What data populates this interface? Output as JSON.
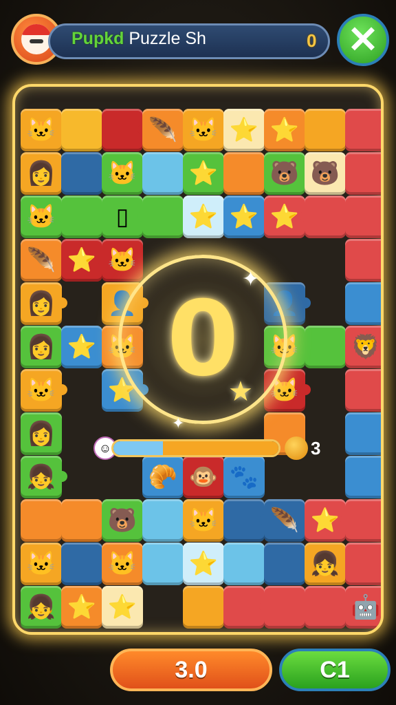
{
  "header": {
    "title_green": "Pupkd",
    "title_rest": " Puzzle Sh",
    "score": "0",
    "close_symbol": "✕",
    "avatar_icon": "mushroom-hat-avatar-icon"
  },
  "board": {
    "center_value": "0",
    "progress_fraction": 0.3,
    "coin_count": "3",
    "rows": [
      [
        {
          "c": "#f5a623",
          "i": "🐱"
        },
        {
          "c": "#f7b92c",
          "i": ""
        },
        {
          "c": "#c92a2a",
          "i": ""
        },
        {
          "c": "#f58b2a",
          "i": "🪶"
        },
        {
          "c": "#f5a623",
          "i": "🐱"
        },
        {
          "c": "#fbe8b0",
          "i": "⭐"
        },
        {
          "c": "#f58b2a",
          "i": "⭐"
        },
        {
          "c": "#f5a623",
          "i": ""
        },
        {
          "c": "#e04a4a",
          "i": ""
        }
      ],
      [
        {
          "c": "#f5a623",
          "i": "👩"
        },
        {
          "c": "#2f6aa5",
          "i": ""
        },
        {
          "c": "#55c23c",
          "i": "🐱"
        },
        {
          "c": "#6cc3e8",
          "i": ""
        },
        {
          "c": "#55c23c",
          "i": "⭐"
        },
        {
          "c": "#f58b2a",
          "i": ""
        },
        {
          "c": "#55c23c",
          "i": "🐻"
        },
        {
          "c": "#fbe8b0",
          "i": "🐻"
        },
        {
          "c": "#e04a4a",
          "i": ""
        }
      ],
      [
        {
          "c": "#55c23c",
          "i": "🐱"
        },
        {
          "c": "#55c23c",
          "i": ""
        },
        {
          "c": "#55c23c",
          "i": "▯"
        },
        {
          "c": "#55c23c",
          "i": ""
        },
        {
          "c": "#cfeefa",
          "i": "⭐"
        },
        {
          "c": "#3b8ed1",
          "i": "⭐"
        },
        {
          "c": "#e04a4a",
          "i": "⭐"
        },
        {
          "c": "#e04a4a",
          "i": ""
        },
        {
          "c": "#e04a4a",
          "i": ""
        }
      ],
      [
        {
          "c": "#f58b2a",
          "i": "🪶"
        },
        {
          "c": "#c92a2a",
          "i": "⭐"
        },
        {
          "c": "#c92a2a",
          "i": "🐱"
        },
        {
          "c": "#2a241c",
          "i": ""
        },
        {
          "c": "#2a241c",
          "i": ""
        },
        {
          "c": "#2a241c",
          "i": ""
        },
        {
          "c": "#2a241c",
          "i": ""
        },
        {
          "c": "#2a241c",
          "i": ""
        },
        {
          "c": "#e04a4a",
          "i": ""
        }
      ],
      [
        {
          "c": "#f5a623",
          "i": "👩"
        },
        {
          "c": "#2a241c",
          "i": ""
        },
        {
          "c": "#f5a623",
          "i": "👤"
        },
        {
          "c": "#2a241c",
          "i": ""
        },
        {
          "c": "#2a241c",
          "i": ""
        },
        {
          "c": "#2a241c",
          "i": ""
        },
        {
          "c": "#2f6aa5",
          "i": "👤"
        },
        {
          "c": "#2a241c",
          "i": ""
        },
        {
          "c": "#3b8ed1",
          "i": ""
        }
      ],
      [
        {
          "c": "#55c23c",
          "i": "👩"
        },
        {
          "c": "#3b8ed1",
          "i": "⭐"
        },
        {
          "c": "#f58b2a",
          "i": "🐱"
        },
        {
          "c": "#2a241c",
          "i": ""
        },
        {
          "c": "#2a241c",
          "i": ""
        },
        {
          "c": "#2a241c",
          "i": ""
        },
        {
          "c": "#55c23c",
          "i": "🐱"
        },
        {
          "c": "#55c23c",
          "i": ""
        },
        {
          "c": "#e04a4a",
          "i": "🦁"
        }
      ],
      [
        {
          "c": "#f5a623",
          "i": "🐱"
        },
        {
          "c": "#2a241c",
          "i": ""
        },
        {
          "c": "#3b8ed1",
          "i": "⭐"
        },
        {
          "c": "#2a241c",
          "i": ""
        },
        {
          "c": "#2a241c",
          "i": ""
        },
        {
          "c": "#2a241c",
          "i": ""
        },
        {
          "c": "#c92a2a",
          "i": "🐱"
        },
        {
          "c": "#2a241c",
          "i": ""
        },
        {
          "c": "#e04a4a",
          "i": ""
        }
      ],
      [
        {
          "c": "#55c23c",
          "i": "👩"
        },
        {
          "c": "#2a241c",
          "i": ""
        },
        {
          "c": "#2a241c",
          "i": ""
        },
        {
          "c": "#2a241c",
          "i": ""
        },
        {
          "c": "#2a241c",
          "i": ""
        },
        {
          "c": "#2a241c",
          "i": ""
        },
        {
          "c": "#f58b2a",
          "i": ""
        },
        {
          "c": "#2a241c",
          "i": ""
        },
        {
          "c": "#3b8ed1",
          "i": ""
        }
      ],
      [
        {
          "c": "#55c23c",
          "i": "👧"
        },
        {
          "c": "#2a241c",
          "i": ""
        },
        {
          "c": "#2a241c",
          "i": ""
        },
        {
          "c": "#3b8ed1",
          "i": "🥐"
        },
        {
          "c": "#c92a2a",
          "i": "🐵"
        },
        {
          "c": "#3b8ed1",
          "i": "🐾"
        },
        {
          "c": "#2a241c",
          "i": ""
        },
        {
          "c": "#2a241c",
          "i": ""
        },
        {
          "c": "#3b8ed1",
          "i": ""
        }
      ],
      [
        {
          "c": "#f58b2a",
          "i": ""
        },
        {
          "c": "#f58b2a",
          "i": ""
        },
        {
          "c": "#55c23c",
          "i": "🐻"
        },
        {
          "c": "#6cc3e8",
          "i": ""
        },
        {
          "c": "#f5a623",
          "i": "🐱"
        },
        {
          "c": "#2f6aa5",
          "i": ""
        },
        {
          "c": "#2f6aa5",
          "i": "🪶"
        },
        {
          "c": "#e04a4a",
          "i": "⭐"
        },
        {
          "c": "#e04a4a",
          "i": ""
        }
      ],
      [
        {
          "c": "#f5a623",
          "i": "🐱"
        },
        {
          "c": "#2f6aa5",
          "i": ""
        },
        {
          "c": "#f58b2a",
          "i": "🐱"
        },
        {
          "c": "#6cc3e8",
          "i": ""
        },
        {
          "c": "#cfeefa",
          "i": "⭐"
        },
        {
          "c": "#6cc3e8",
          "i": ""
        },
        {
          "c": "#2f6aa5",
          "i": ""
        },
        {
          "c": "#f5a623",
          "i": "👧"
        },
        {
          "c": "#e04a4a",
          "i": ""
        }
      ],
      [
        {
          "c": "#55c23c",
          "i": "👧"
        },
        {
          "c": "#f58b2a",
          "i": "⭐"
        },
        {
          "c": "#fbe8b0",
          "i": "⭐"
        },
        {
          "c": "#2a241c",
          "i": ""
        },
        {
          "c": "#f5a623",
          "i": ""
        },
        {
          "c": "#e04a4a",
          "i": ""
        },
        {
          "c": "#e04a4a",
          "i": ""
        },
        {
          "c": "#e04a4a",
          "i": ""
        },
        {
          "c": "#e04a4a",
          "i": "🤖"
        }
      ]
    ]
  },
  "buttons": {
    "orange_label": "3.0",
    "green_label": "C1"
  }
}
